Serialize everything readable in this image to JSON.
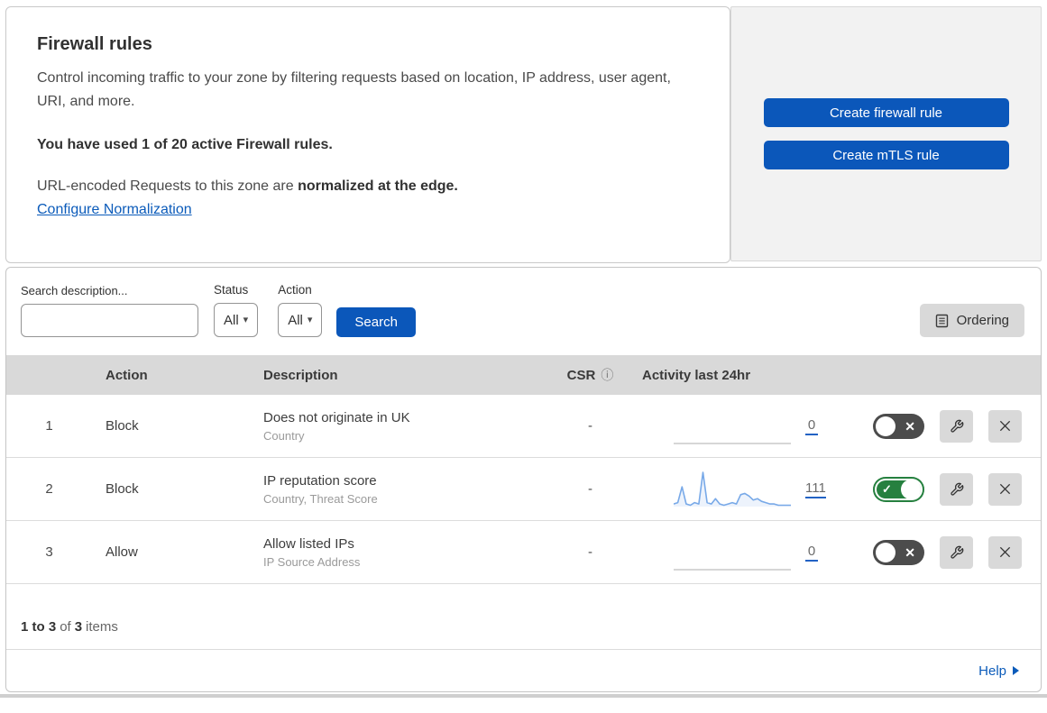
{
  "colors": {
    "primary_blue": "#0b57ba",
    "link_blue": "#0b5bba",
    "toggle_on_green": "#26803f",
    "toggle_off_gray": "#4c4c4c",
    "table_header_gray": "#d9d9d9",
    "side_panel_gray": "#f2f2f2",
    "sparkline_blue": "#78a9e8"
  },
  "intro": {
    "title": "Firewall rules",
    "description": "Control incoming traffic to your zone by filtering requests based on location, IP address, user agent, URI, and more.",
    "usage": "You have used 1 of 20 active Firewall rules.",
    "normalization_prefix": "URL-encoded Requests to this zone are ",
    "normalization_bold": "normalized at the edge.",
    "normalization_link": "Configure Normalization",
    "create_firewall_button": "Create firewall rule",
    "create_mtls_button": "Create mTLS rule"
  },
  "filters": {
    "search_label": "Search description...",
    "search_value": "",
    "status_label": "Status",
    "status_value": "All",
    "action_label": "Action",
    "action_value": "All",
    "search_button": "Search",
    "ordering_button": "Ordering"
  },
  "table": {
    "columns": {
      "action": "Action",
      "description": "Description",
      "csr": "CSR",
      "activity": "Activity last 24hr"
    },
    "rows": [
      {
        "index": "1",
        "action": "Block",
        "description": "Does not originate in UK",
        "fields": "Country",
        "csr": "-",
        "activity_count": "0",
        "enabled": false,
        "sparkline_points": [
          0,
          0,
          0,
          0,
          0,
          0,
          0,
          0,
          0,
          0,
          0,
          0,
          0,
          0,
          0,
          0,
          0,
          0,
          0,
          0,
          0,
          0,
          0,
          0,
          0,
          0,
          0,
          0,
          0
        ]
      },
      {
        "index": "2",
        "action": "Block",
        "description": "IP reputation score",
        "fields": "Country, Threat Score",
        "csr": "-",
        "activity_count": "111",
        "enabled": true,
        "sparkline_points": [
          2,
          3,
          15,
          2,
          1,
          3,
          2,
          26,
          3,
          2,
          6,
          2,
          1,
          2,
          3,
          2,
          9,
          10,
          8,
          5,
          6,
          4,
          3,
          2,
          2,
          1,
          1,
          1,
          1
        ]
      },
      {
        "index": "3",
        "action": "Allow",
        "description": "Allow listed IPs",
        "fields": "IP Source Address",
        "csr": "-",
        "activity_count": "0",
        "enabled": false,
        "sparkline_points": [
          0,
          0,
          0,
          0,
          0,
          0,
          0,
          0,
          0,
          0,
          0,
          0,
          0,
          0,
          0,
          0,
          0,
          0,
          0,
          0,
          0,
          0,
          0,
          0,
          0,
          0,
          0,
          0,
          0
        ]
      }
    ]
  },
  "footer": {
    "range": "1 to 3",
    "of": "of",
    "total": "3",
    "items": "items"
  },
  "help": {
    "label": "Help"
  },
  "icons": {
    "check": "✓",
    "x": "✕",
    "caret": "▾",
    "info": "ⓘ"
  }
}
